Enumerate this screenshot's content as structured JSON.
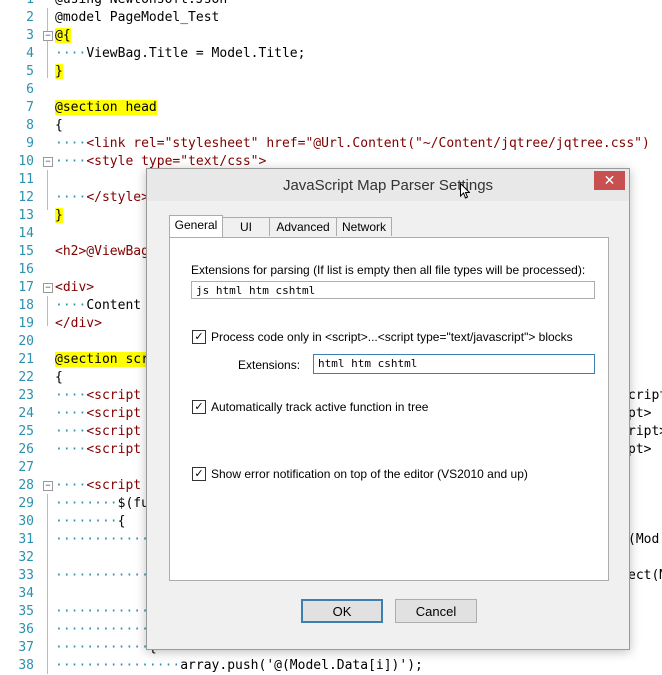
{
  "editor": {
    "lines": [
      {
        "n": "1",
        "text": "@using Newtonsoft.Json"
      },
      {
        "n": "2",
        "text": "@model PageModel_Test"
      },
      {
        "n": "3",
        "text": "@{"
      },
      {
        "n": "4",
        "text": "····ViewBag.Title = Model.Title;"
      },
      {
        "n": "5",
        "text": "}"
      },
      {
        "n": "6",
        "text": ""
      },
      {
        "n": "7",
        "text": "@section head"
      },
      {
        "n": "8",
        "text": "{"
      },
      {
        "n": "9",
        "text": "····<link rel=\"stylesheet\" href=\"@Url.Content(\"~/Content/jqtree/jqtree.css\")"
      },
      {
        "n": "10",
        "text": "····<style type=\"text/css\">"
      },
      {
        "n": "11",
        "text": ""
      },
      {
        "n": "12",
        "text": "····</style>"
      },
      {
        "n": "13",
        "text": "}"
      },
      {
        "n": "14",
        "text": ""
      },
      {
        "n": "15",
        "text": "<h2>@ViewBag"
      },
      {
        "n": "16",
        "text": ""
      },
      {
        "n": "17",
        "text": "<div>"
      },
      {
        "n": "18",
        "text": "····Content"
      },
      {
        "n": "19",
        "text": "</div>"
      },
      {
        "n": "20",
        "text": ""
      },
      {
        "n": "21",
        "text": "@section scr"
      },
      {
        "n": "22",
        "text": "{"
      },
      {
        "n": "23",
        "text": "····<script"
      },
      {
        "n": "24",
        "text": "····<script"
      },
      {
        "n": "25",
        "text": "····<script"
      },
      {
        "n": "26",
        "text": "····<script"
      },
      {
        "n": "27",
        "text": ""
      },
      {
        "n": "28",
        "text": "····<script"
      },
      {
        "n": "29",
        "text": "········$(fu"
      },
      {
        "n": "30",
        "text": "········{"
      },
      {
        "n": "31",
        "text": "············"
      },
      {
        "n": "32",
        "text": ""
      },
      {
        "n": "33",
        "text": "············"
      },
      {
        "n": "34",
        "text": ""
      },
      {
        "n": "35",
        "text": "············"
      },
      {
        "n": "36",
        "text": "············"
      },
      {
        "n": "37",
        "text": "············{"
      },
      {
        "n": "38",
        "text": "················array.push('@(Model.Data[i])');"
      }
    ],
    "right_fragments": [
      {
        "line": "23",
        "text": "cript"
      },
      {
        "line": "24",
        "text": "pt>"
      },
      {
        "line": "25",
        "text": "ript>"
      },
      {
        "line": "26",
        "text": "pt>"
      },
      {
        "line": "31",
        "text": "(Mod"
      },
      {
        "line": "33",
        "text": "ect(M"
      }
    ]
  },
  "dialog": {
    "title": "JavaScript Map Parser Settings",
    "close_glyph": "✕",
    "tabs": [
      {
        "label": "General",
        "active": true
      },
      {
        "label": "UI",
        "active": false
      },
      {
        "label": "Advanced",
        "active": false
      },
      {
        "label": "Network",
        "active": false
      }
    ],
    "general": {
      "extensions_label": "Extensions for parsing (If list is empty then all file types will be processed):",
      "extensions_value": "js html htm cshtml",
      "process_code_label": "Process code only in <script>...<script type=\"text/javascript\"> blocks",
      "process_code_checked": true,
      "sub_extensions_label": "Extensions:",
      "sub_extensions_value": "html htm cshtml",
      "auto_track_label": "Automatically track active function in tree",
      "auto_track_checked": true,
      "show_error_label": "Show error notification on top of the editor (VS2010 and up)",
      "show_error_checked": true
    },
    "buttons": {
      "ok": "OK",
      "cancel": "Cancel"
    },
    "check_glyph": "✓"
  }
}
